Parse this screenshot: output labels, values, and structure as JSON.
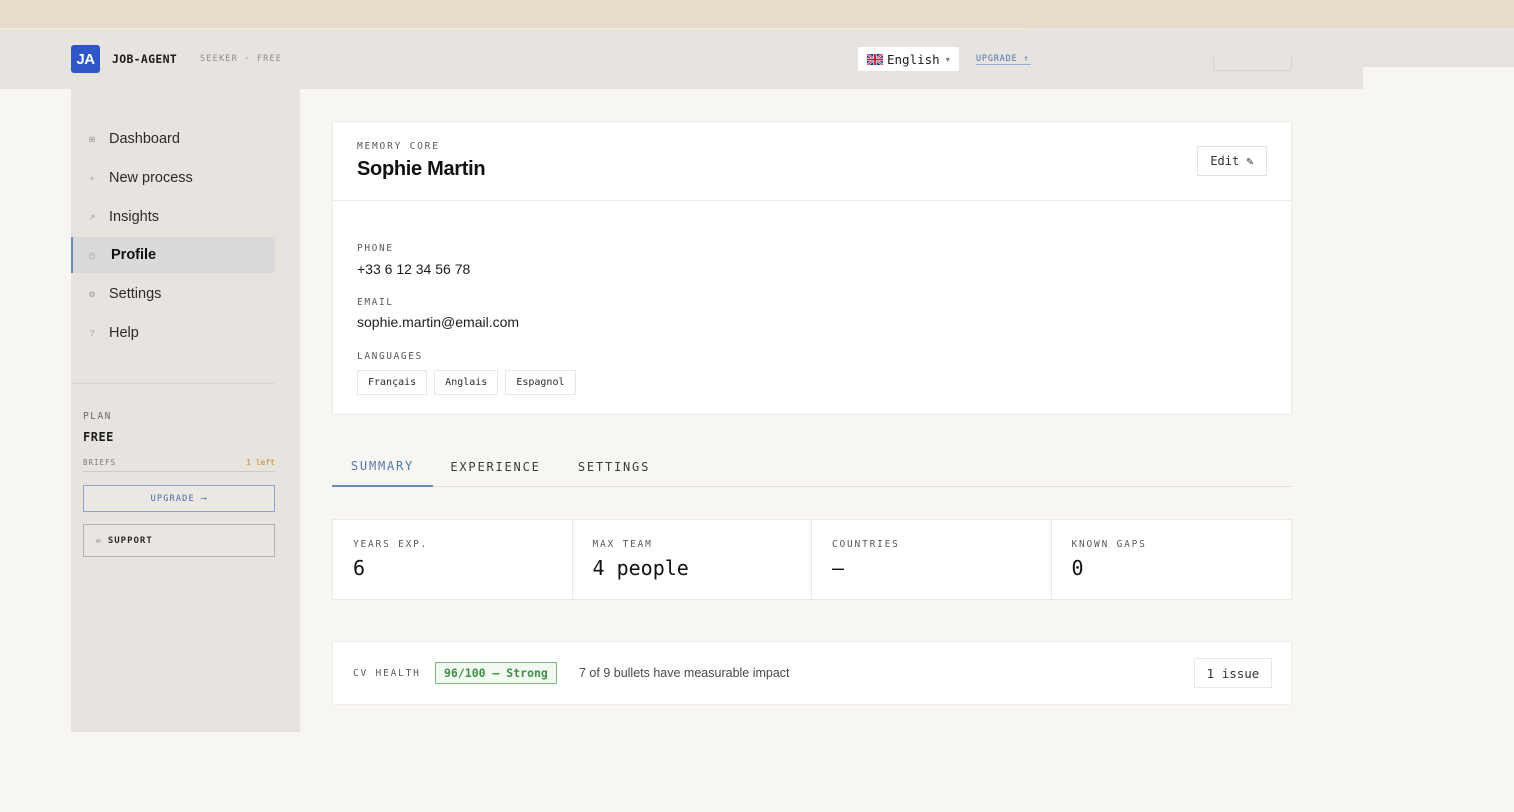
{
  "header": {
    "logo_text": "JA",
    "brand": "JOB-AGENT",
    "tier": "SEEKER · FREE",
    "language": "English",
    "language_caret": "▾",
    "upgrade_link": "UPGRADE ↑"
  },
  "sidebar": {
    "items": [
      {
        "label": "Dashboard",
        "icon": "grid-icon",
        "glyph": "⊞",
        "active": false
      },
      {
        "label": "New process",
        "icon": "plus-icon",
        "glyph": "+",
        "active": false
      },
      {
        "label": "Insights",
        "icon": "trend-icon",
        "glyph": "↗",
        "active": false
      },
      {
        "label": "Profile",
        "icon": "profile-icon",
        "glyph": "◷",
        "active": true
      },
      {
        "label": "Settings",
        "icon": "gear-icon",
        "glyph": "⚙",
        "active": false
      },
      {
        "label": "Help",
        "icon": "help-icon",
        "glyph": "?",
        "active": false
      }
    ],
    "plan_label": "PLAN",
    "plan_value": "FREE",
    "briefs_label": "BRIEFS",
    "briefs_count": "1 left",
    "upgrade_button": "UPGRADE ⟶",
    "support_icon": "✉",
    "support_button": "SUPPORT"
  },
  "profile": {
    "eyebrow": "MEMORY CORE",
    "name": "Sophie Martin",
    "edit_button": "Edit ✎",
    "phone_label": "PHONE",
    "phone": "+33 6 12 34 56 78",
    "email_label": "EMAIL",
    "email": "sophie.martin@email.com",
    "languages_label": "LANGUAGES",
    "languages": [
      "Français",
      "Anglais",
      "Espagnol"
    ]
  },
  "tabs": [
    {
      "label": "SUMMARY",
      "active": true
    },
    {
      "label": "EXPERIENCE",
      "active": false
    },
    {
      "label": "SETTINGS",
      "active": false
    }
  ],
  "stats": [
    {
      "label": "YEARS EXP.",
      "value": "6"
    },
    {
      "label": "MAX TEAM",
      "value": "4 people"
    },
    {
      "label": "COUNTRIES",
      "value": "—"
    },
    {
      "label": "KNOWN GAPS",
      "value": "0"
    }
  ],
  "cv_health": {
    "label": "CV HEALTH",
    "score": "96/100 — Strong",
    "detail": "7 of 9 bullets have measurable impact",
    "issues_button": "1 issue"
  },
  "colors": {
    "accent": "#2f56c6",
    "active_tab": "#5876a8",
    "success": "#3f8d4a",
    "briefs_warning": "#c98a2a"
  }
}
